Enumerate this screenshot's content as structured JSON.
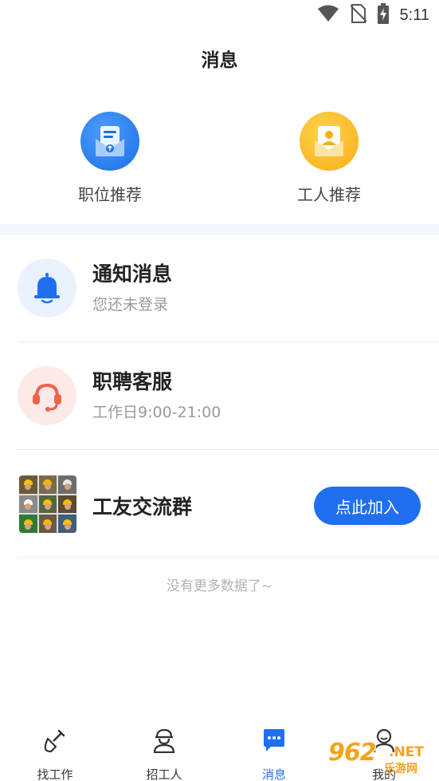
{
  "status_bar": {
    "time": "5:11"
  },
  "header": {
    "title": "消息"
  },
  "shortcuts": [
    {
      "label": "职位推荐",
      "icon": "job-recommend-icon"
    },
    {
      "label": "工人推荐",
      "icon": "worker-recommend-icon"
    }
  ],
  "messages": [
    {
      "title": "通知消息",
      "subtitle": "您还未登录",
      "icon": "bell-icon"
    },
    {
      "title": "职聘客服",
      "subtitle": "工作日9:00-21:00",
      "icon": "headset-icon"
    },
    {
      "title": "工友交流群",
      "button": "点此加入",
      "icon": "group-photo-icon"
    }
  ],
  "footer_note": "没有更多数据了~",
  "bottom_nav": [
    {
      "label": "找工作",
      "icon": "shovel-icon",
      "active": false
    },
    {
      "label": "招工人",
      "icon": "worker-helmet-icon",
      "active": false
    },
    {
      "label": "消息",
      "icon": "chat-bubble-icon",
      "active": true
    },
    {
      "label": "我的",
      "icon": "user-icon",
      "active": false
    }
  ],
  "watermark": {
    "number": "962",
    "suffix": ".NET",
    "site": "乐游网"
  },
  "colors": {
    "accent": "#1f6ff0",
    "bell_bg": "#e9f1fd",
    "service_bg": "#fde9e6",
    "worker_yellow": "#f7ad1a"
  }
}
